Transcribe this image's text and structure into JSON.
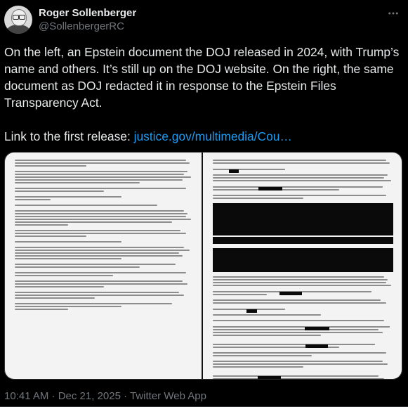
{
  "author": {
    "display_name": "Roger Sollenberger",
    "handle": "@SollenbergerRC",
    "avatar_icon": "profile-photo"
  },
  "more_icon": "more-icon",
  "tweet": {
    "paragraph1": "On the left, an Epstein document the DOJ released in 2024, with Trump’s name and others. It’s still up on the DOJ website. On the right, the same document as DOJ redacted it in response to the Epstein Files Transparency Act.",
    "link_prefix": "Link to the first release: ",
    "link_text": "justice.gov/multimedia/Cou…"
  },
  "media": {
    "left_alt": "Unredacted document page",
    "right_alt": "Redacted document page"
  },
  "meta": {
    "timestamp": "10:41 AM · Dec 21, 2025 · Twitter Web App"
  },
  "colors": {
    "background": "#000000",
    "text": "#e7e9ea",
    "secondary": "#71767b",
    "link": "#1d9bf0"
  }
}
